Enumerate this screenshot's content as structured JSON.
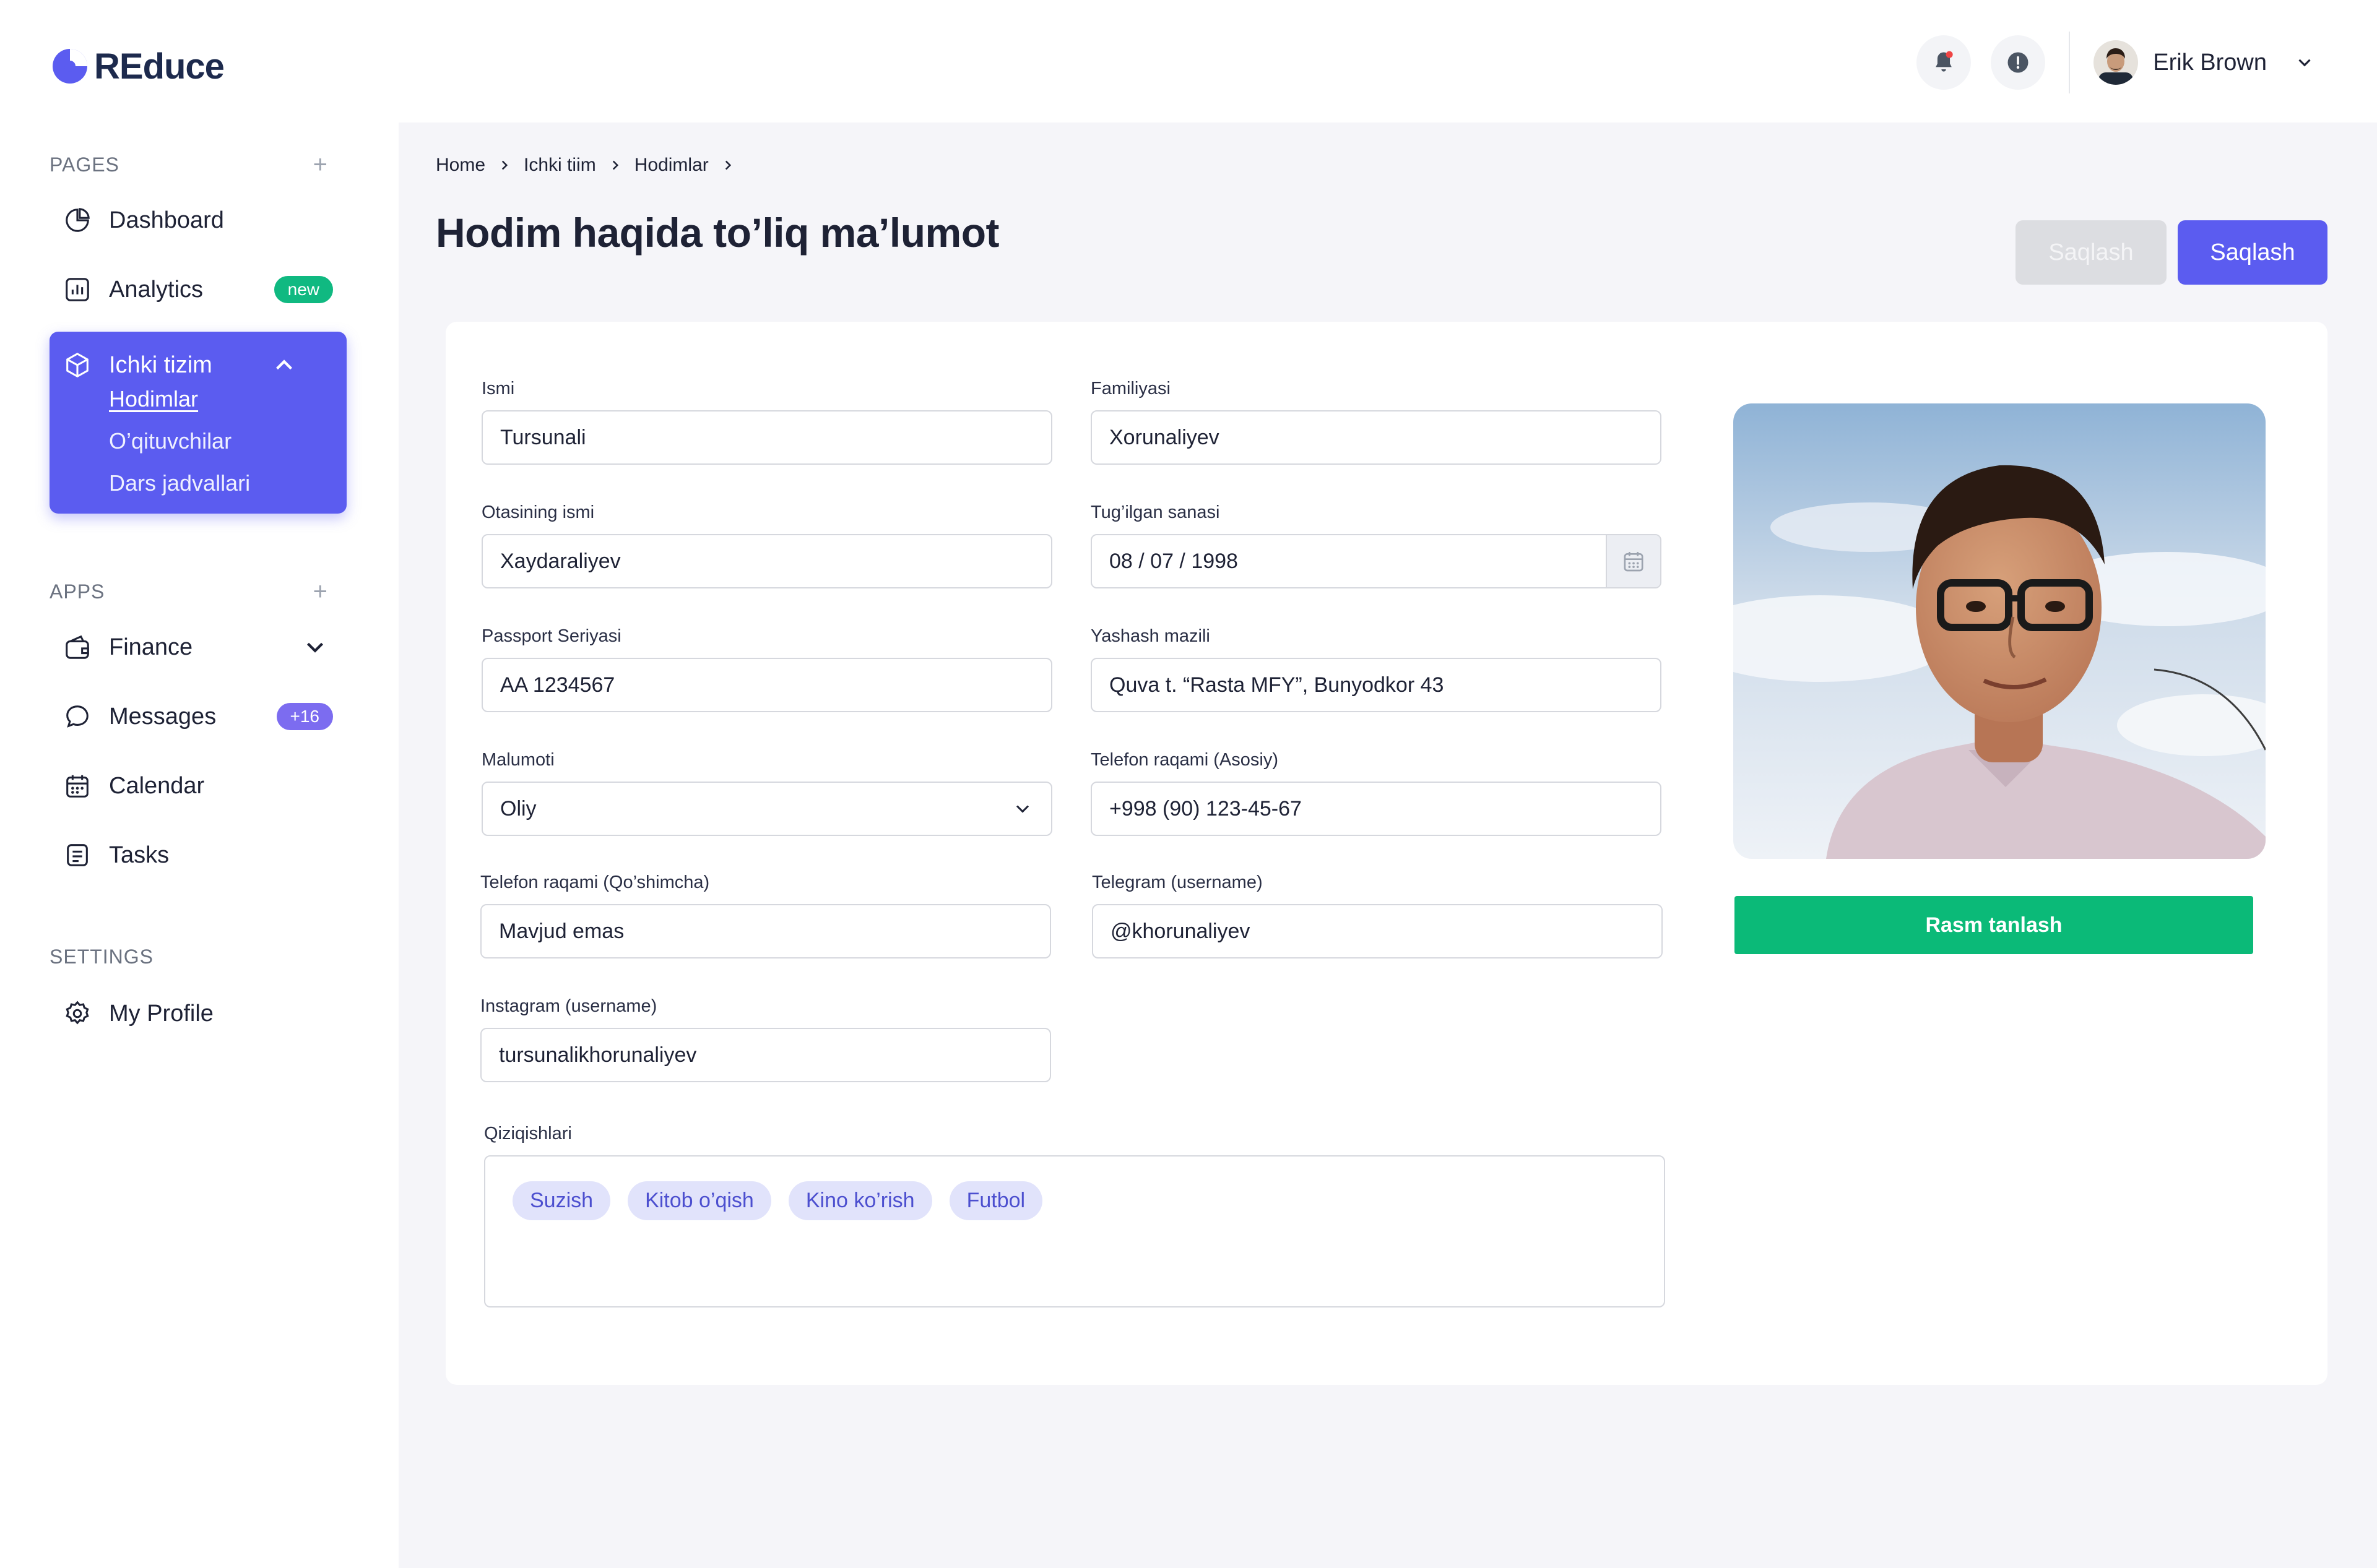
{
  "app": {
    "logo_text": "REduce"
  },
  "sidebar": {
    "pages_heading": "PAGES",
    "apps_heading": "APPS",
    "settings_heading": "SETTINGS",
    "items": {
      "dashboard": "Dashboard",
      "analytics": "Analytics",
      "analytics_badge": "new",
      "ichki_tizim": "Ichki tizim",
      "hodimlar": "Hodimlar",
      "oqituvchilar": "O’qituvchilar",
      "dars_jadvallari": "Dars jadvallari",
      "finance": "Finance",
      "messages": "Messages",
      "messages_badge": "+16",
      "calendar": "Calendar",
      "tasks": "Tasks",
      "my_profile": "My Profile"
    }
  },
  "header": {
    "user_name": "Erik Brown"
  },
  "breadcrumb": [
    "Home",
    "Ichki tiim",
    "Hodimlar"
  ],
  "page_title": "Hodim haqida to’liq ma’lumot",
  "buttons": {
    "save_disabled": "Saqlash",
    "save": "Saqlash",
    "pick_photo": "Rasm tanlash"
  },
  "form": {
    "first_name": {
      "label": "Ismi",
      "value": "Tursunali"
    },
    "last_name": {
      "label": "Familiyasi",
      "value": "Xorunaliyev"
    },
    "father_name": {
      "label": "Otasining ismi",
      "value": "Xaydaraliyev"
    },
    "birth_date": {
      "label": "Tug’ilgan sanasi",
      "value": "08 / 07 / 1998"
    },
    "passport": {
      "label": "Passport Seriyasi",
      "value": "AA 1234567"
    },
    "address": {
      "label": "Yashash mazili",
      "value": "Quva t. “Rasta MFY”, Bunyodkor 43"
    },
    "education": {
      "label": "Malumoti",
      "value": "Oliy"
    },
    "phone_main": {
      "label": "Telefon raqami (Asosiy)",
      "value": "+998 (90) 123-45-67"
    },
    "phone_extra": {
      "label": "Telefon raqami (Qo’shimcha)",
      "value": "Mavjud emas"
    },
    "telegram": {
      "label": "Telegram (username)",
      "value": "@khorunaliyev"
    },
    "instagram": {
      "label": "Instagram (username)",
      "value": "tursunalikhorunaliyev"
    },
    "interests": {
      "label": "Qiziqishlari",
      "tags": [
        "Suzish",
        "Kitob o’qish",
        "Kino ko’rish",
        "Futbol"
      ]
    }
  },
  "colors": {
    "accent": "#5b5cf0",
    "success": "#0bba78",
    "new_badge": "#10b981"
  }
}
